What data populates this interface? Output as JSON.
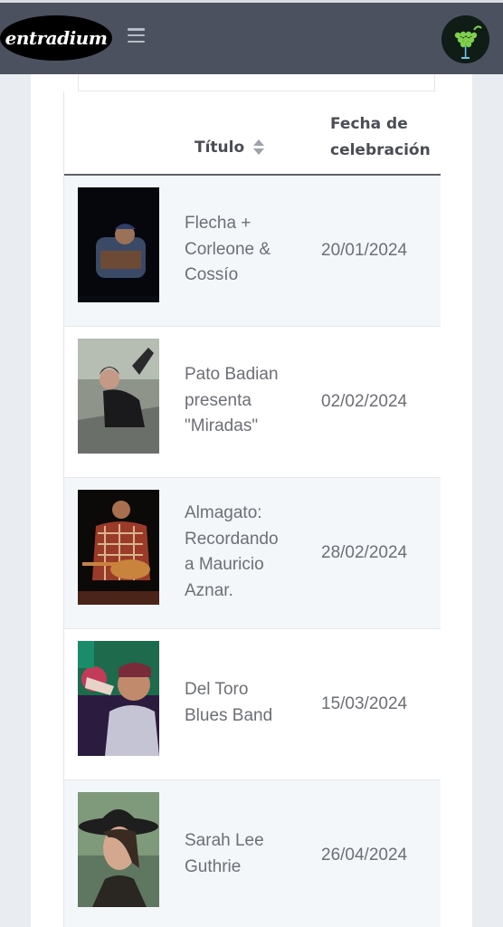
{
  "brand": {
    "logo_text": "entradium"
  },
  "table": {
    "columns": {
      "title": "Título",
      "date_line1": "Fecha de",
      "date_line2": "celebración"
    },
    "rows": [
      {
        "title_lines": [
          "Flecha +",
          "Corleone &",
          "Cossío"
        ],
        "date": "20/01/2024"
      },
      {
        "title_lines": [
          "Pato Badian",
          "presenta",
          "\"Miradas\""
        ],
        "date": "02/02/2024"
      },
      {
        "title_lines": [
          "Almagato:",
          "Recordando",
          "a Mauricio",
          "Aznar."
        ],
        "date": "28/02/2024"
      },
      {
        "title_lines": [
          "Del Toro",
          "Blues Band"
        ],
        "date": "15/03/2024"
      },
      {
        "title_lines": [
          "Sarah Lee",
          "Guthrie"
        ],
        "date": "26/04/2024"
      }
    ]
  },
  "colors": {
    "navbar": "#4c5160",
    "row_stripe": "#f4f7fa",
    "text": "#6c6f76",
    "header_text": "#4a4d54"
  }
}
